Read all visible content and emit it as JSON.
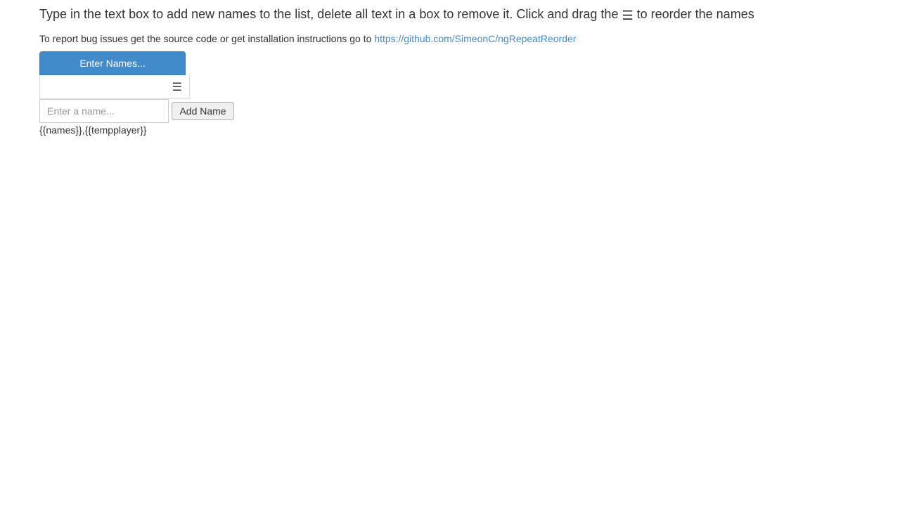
{
  "intro": {
    "text_before": "Type in the text box to add new names to the list, delete all text in a box to remove it. Click and drag the ",
    "drag_glyph": "☰",
    "text_after": " to reorder the names"
  },
  "report": {
    "prefix": "To report bug issues get the source code or get installation instructions go to ",
    "link_text": "https://github.com/SimeonC/ngRepeatReorder"
  },
  "panel": {
    "heading": "Enter Names..."
  },
  "row": {
    "drag_glyph": "☰"
  },
  "add": {
    "placeholder": "Enter a name...",
    "button_label": "Add Name"
  },
  "output_raw": "{{names}},{{tempplayer}}"
}
